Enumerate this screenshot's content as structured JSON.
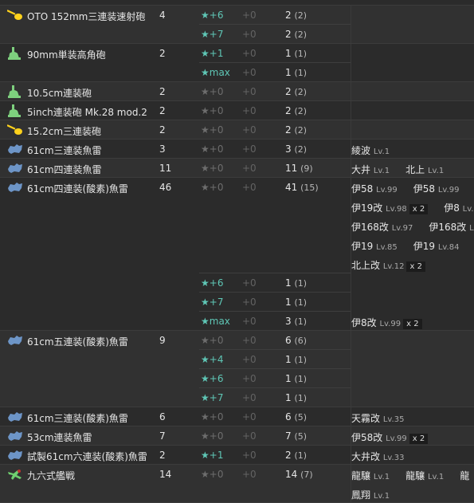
{
  "equipment_rows": [
    {
      "name": "OTO 152mm三連装速射砲",
      "count": "4",
      "icon": "yellow-gun-icon",
      "variants": [
        {
          "improvement": "★+6",
          "proficiency": "+0",
          "qty": "2",
          "sub": "(2)",
          "ships": []
        },
        {
          "improvement": "★+7",
          "proficiency": "+0",
          "qty": "2",
          "sub": "(2)",
          "ships": []
        }
      ]
    },
    {
      "name": "90mm単装高角砲",
      "count": "2",
      "icon": "green-aa-gun-icon",
      "variants": [
        {
          "improvement": "★+1",
          "proficiency": "+0",
          "qty": "1",
          "sub": "(1)",
          "ships": []
        },
        {
          "improvement": "★max",
          "proficiency": "+0",
          "qty": "1",
          "sub": "(1)",
          "ships": []
        }
      ]
    },
    {
      "name": "10.5cm連装砲",
      "count": "2",
      "icon": "green-aa-gun-icon",
      "variants": [
        {
          "improvement": "★+0",
          "proficiency": "+0",
          "qty": "2",
          "sub": "(2)",
          "ships": []
        }
      ]
    },
    {
      "name": "5inch連装砲 Mk.28 mod.2",
      "count": "2",
      "icon": "green-aa-gun-icon",
      "variants": [
        {
          "improvement": "★+0",
          "proficiency": "+0",
          "qty": "2",
          "sub": "(2)",
          "ships": []
        }
      ]
    },
    {
      "name": "15.2cm三連装砲",
      "count": "2",
      "icon": "yellow-gun-icon",
      "variants": [
        {
          "improvement": "★+0",
          "proficiency": "+0",
          "qty": "2",
          "sub": "(2)",
          "ships": []
        }
      ]
    },
    {
      "name": "61cm三連装魚雷",
      "count": "3",
      "icon": "torpedo-icon",
      "variants": [
        {
          "improvement": "★+0",
          "proficiency": "+0",
          "qty": "3",
          "sub": "(2)",
          "ships": [
            [
              {
                "name": "綾波",
                "lv": "Lv.1"
              }
            ]
          ]
        }
      ]
    },
    {
      "name": "61cm四連装魚雷",
      "count": "11",
      "icon": "torpedo-icon",
      "variants": [
        {
          "improvement": "★+0",
          "proficiency": "+0",
          "qty": "11",
          "sub": "(9)",
          "ships": [
            [
              {
                "name": "大井",
                "lv": "Lv.1"
              },
              {
                "name": "北上",
                "lv": "Lv.1"
              }
            ]
          ]
        }
      ]
    },
    {
      "name": "61cm四連装(酸素)魚雷",
      "count": "46",
      "icon": "torpedo-icon",
      "variants": [
        {
          "improvement": "★+0",
          "proficiency": "+0",
          "qty": "41",
          "sub": "(15)",
          "ships": [
            [
              {
                "name": "伊58",
                "lv": "Lv.99"
              },
              {
                "name": "伊58",
                "lv": "Lv.99"
              }
            ],
            [
              {
                "name": "伊19改",
                "lv": "Lv.98",
                "mult": "x 2"
              },
              {
                "name": "伊8",
                "lv": "Lv."
              }
            ],
            [
              {
                "name": "伊168改",
                "lv": "Lv.97"
              },
              {
                "name": "伊168改",
                "lv": "Lv."
              }
            ],
            [
              {
                "name": "伊19",
                "lv": "Lv.85"
              },
              {
                "name": "伊19",
                "lv": "Lv.84"
              }
            ],
            [
              {
                "name": "北上改",
                "lv": "Lv.12",
                "mult": "x 2"
              }
            ]
          ]
        },
        {
          "improvement": "★+6",
          "proficiency": "+0",
          "qty": "1",
          "sub": "(1)",
          "ships": []
        },
        {
          "improvement": "★+7",
          "proficiency": "+0",
          "qty": "1",
          "sub": "(1)",
          "ships": []
        },
        {
          "improvement": "★max",
          "proficiency": "+0",
          "qty": "3",
          "sub": "(1)",
          "ships": [
            [
              {
                "name": "伊8改",
                "lv": "Lv.99",
                "mult": "x 2"
              }
            ]
          ]
        }
      ]
    },
    {
      "name": "61cm五連装(酸素)魚雷",
      "count": "9",
      "icon": "torpedo-icon",
      "variants": [
        {
          "improvement": "★+0",
          "proficiency": "+0",
          "qty": "6",
          "sub": "(6)",
          "ships": []
        },
        {
          "improvement": "★+4",
          "proficiency": "+0",
          "qty": "1",
          "sub": "(1)",
          "ships": []
        },
        {
          "improvement": "★+6",
          "proficiency": "+0",
          "qty": "1",
          "sub": "(1)",
          "ships": []
        },
        {
          "improvement": "★+7",
          "proficiency": "+0",
          "qty": "1",
          "sub": "(1)",
          "ships": []
        }
      ]
    },
    {
      "name": "61cm三連装(酸素)魚雷",
      "count": "6",
      "icon": "torpedo-icon",
      "variants": [
        {
          "improvement": "★+0",
          "proficiency": "+0",
          "qty": "6",
          "sub": "(5)",
          "ships": [
            [
              {
                "name": "天霧改",
                "lv": "Lv.35"
              }
            ]
          ]
        }
      ]
    },
    {
      "name": "53cm連装魚雷",
      "count": "7",
      "icon": "torpedo-icon",
      "variants": [
        {
          "improvement": "★+0",
          "proficiency": "+0",
          "qty": "7",
          "sub": "(5)",
          "ships": [
            [
              {
                "name": "伊58改",
                "lv": "Lv.99",
                "mult": "x 2"
              }
            ]
          ]
        }
      ]
    },
    {
      "name": "試製61cm六連装(酸素)魚雷",
      "count": "2",
      "icon": "torpedo-icon",
      "variants": [
        {
          "improvement": "★+1",
          "proficiency": "+0",
          "qty": "2",
          "sub": "(1)",
          "ships": [
            [
              {
                "name": "大井改",
                "lv": "Lv.33"
              }
            ]
          ]
        }
      ]
    },
    {
      "name": "九六式艦戦",
      "count": "14",
      "icon": "green-fighter-plane-icon",
      "variants": [
        {
          "improvement": "★+0",
          "proficiency": "+0",
          "qty": "14",
          "sub": "(7)",
          "ships": [
            [
              {
                "name": "龍驤",
                "lv": "Lv.1"
              },
              {
                "name": "龍驤",
                "lv": "Lv.1"
              },
              {
                "name": "龍",
                "lv": ""
              }
            ],
            [
              {
                "name": "鳳翔",
                "lv": "Lv.1"
              }
            ]
          ]
        }
      ]
    }
  ],
  "colors": {
    "background": "#2b2b2b",
    "star_active": "#5fc7b6",
    "star_inactive": "#6d6d6d",
    "yellow_icon": "#ffd21c",
    "green_icon": "#7ed07e",
    "torpedo_icon": "#6d95c7"
  }
}
